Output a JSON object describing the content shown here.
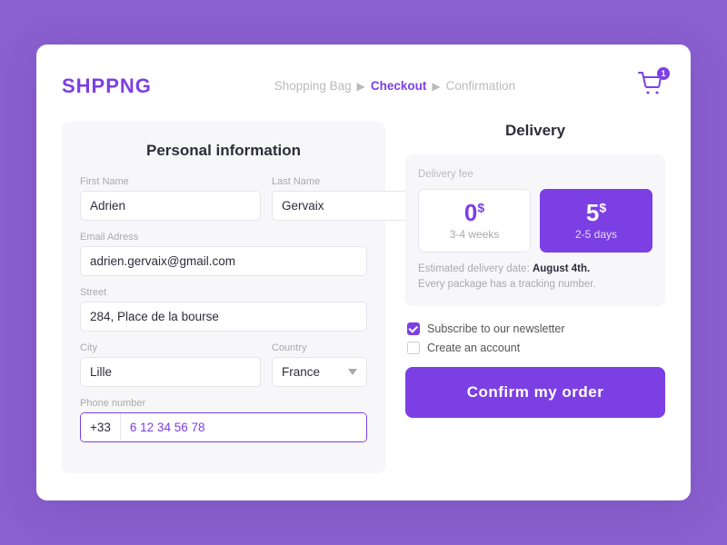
{
  "app": {
    "logo": "SHPPNG",
    "cart_badge": "1"
  },
  "breadcrumb": {
    "step1": "Shopping Bag",
    "sep1": "▶",
    "step2": "Checkout",
    "sep2": "▶",
    "step3": "Confirmation"
  },
  "personal": {
    "title": "Personal information",
    "first_name_label": "First Name",
    "first_name_value": "Adrien",
    "last_name_label": "Last Name",
    "last_name_value": "Gervaix",
    "email_label": "Email Adress",
    "email_value": "adrien.gervaix@gmail.com",
    "street_label": "Street",
    "street_value": "284, Place de la bourse",
    "city_label": "City",
    "city_value": "Lille",
    "country_label": "Country",
    "country_value": "France",
    "phone_label": "Phone number",
    "phone_prefix": "+33",
    "phone_value": "6 12 34 56 78"
  },
  "delivery": {
    "title": "Delivery",
    "fee_label": "Delivery fee",
    "option1": {
      "price": "0",
      "currency": "$",
      "duration": "3-4 weeks"
    },
    "option2": {
      "price": "5",
      "currency": "$",
      "duration": "2-5 days"
    },
    "note_prefix": "Estimated delivery date: ",
    "note_bold": "August 4th.",
    "note_suffix": "\nEvery package has a tracking number.",
    "newsletter_label": "Subscribe to our newsletter",
    "account_label": "Create an account"
  },
  "cta": {
    "confirm_label": "Confirm my order"
  }
}
